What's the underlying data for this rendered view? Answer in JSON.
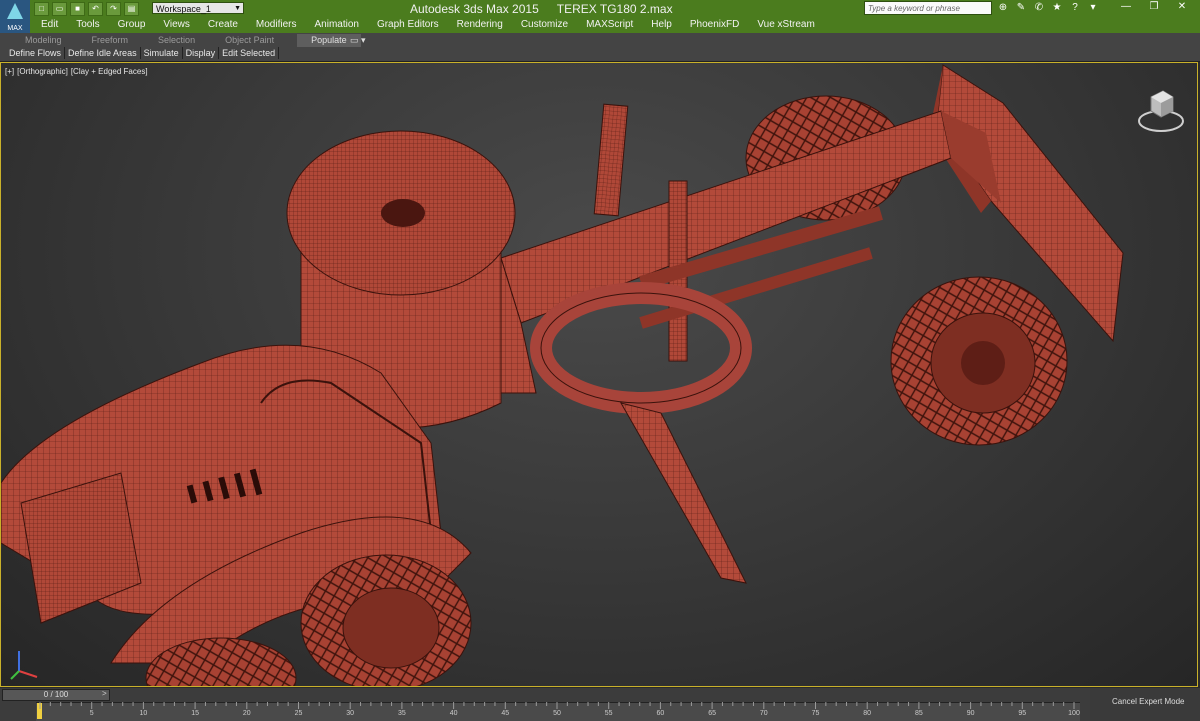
{
  "app": {
    "icon_label": "MAX",
    "title": "Autodesk 3ds Max  2015",
    "document": "TEREX TG180 2.max",
    "workspace": "Workspace_1",
    "search_placeholder": "Type a keyword or phrase"
  },
  "menu": [
    "Edit",
    "Tools",
    "Group",
    "Views",
    "Create",
    "Modifiers",
    "Animation",
    "Graph Editors",
    "Rendering",
    "Customize",
    "MAXScript",
    "Help",
    "PhoenixFD",
    "Vue xStream"
  ],
  "ribbon": {
    "tabs": [
      {
        "label": "Modeling",
        "active": false
      },
      {
        "label": "Freeform",
        "active": false
      },
      {
        "label": "Selection",
        "active": false
      },
      {
        "label": "Object Paint",
        "active": false
      },
      {
        "label": "Populate",
        "active": true
      }
    ],
    "tools": [
      "Define Flows",
      "Define Idle Areas",
      "Simulate",
      "Display",
      "Edit Selected"
    ]
  },
  "viewport": {
    "labels": [
      "[+]",
      "[Orthographic]",
      "[Clay + Edged Faces]"
    ],
    "model_color": "#b34a3a",
    "border_color": "#c9b12a"
  },
  "timeline": {
    "range": "0 / 100",
    "next": ">",
    "ticks": [
      5,
      10,
      15,
      20,
      25,
      30,
      35,
      40,
      45,
      50,
      55,
      60,
      65,
      70,
      75,
      80,
      85,
      90,
      95,
      100
    ],
    "max": 100,
    "current": 0
  },
  "status": {
    "cancel_expert": "Cancel Expert Mode"
  },
  "icons": {
    "app": "3ds-max-logo-icon",
    "viewcube": "viewcube-icon",
    "axis": "axis-tripod-icon"
  }
}
